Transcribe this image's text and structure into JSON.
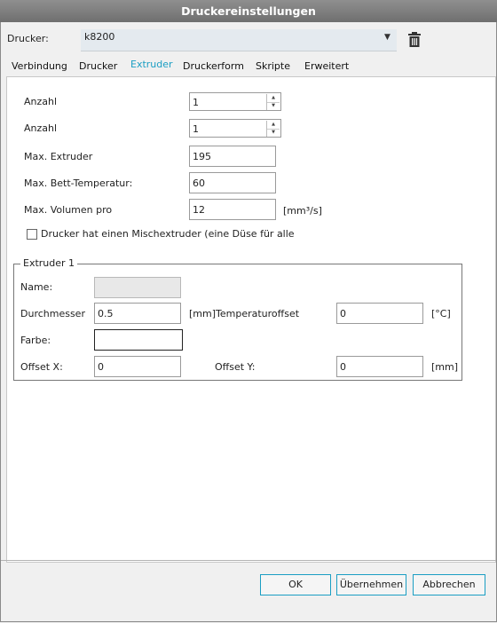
{
  "window": {
    "title": "Druckereinstellungen"
  },
  "printer": {
    "label": "Drucker:",
    "selected": "k8200"
  },
  "icons": {
    "dropdown": "chevron-down-icon",
    "delete": "trash-icon"
  },
  "tabs": [
    {
      "label": "Verbindung"
    },
    {
      "label": "Drucker"
    },
    {
      "label": "Extruder"
    },
    {
      "label": "Druckerform"
    },
    {
      "label": "Skripte"
    },
    {
      "label": "Erweitert"
    }
  ],
  "extruder": {
    "count1_label": "Anzahl",
    "count1_value": "1",
    "count2_label": "Anzahl",
    "count2_value": "1",
    "max_extruder_label": "Max. Extruder",
    "max_extruder_value": "195",
    "max_bed_label": "Max. Bett-Temperatur:",
    "max_bed_value": "60",
    "max_volume_label": "Max. Volumen pro",
    "max_volume_value": "12",
    "max_volume_unit": "[mm³/s]",
    "mixing_label": "Drucker hat einen Mischextruder (eine Düse für alle"
  },
  "extruder1": {
    "title": "Extruder 1",
    "name_label": "Name:",
    "name_value": "",
    "diameter_label": "Durchmesser",
    "diameter_value": "0.5",
    "diameter_unit": "[mm]",
    "temp_offset_label": "Temperaturoffset",
    "temp_offset_value": "0",
    "temp_offset_unit": "[°C]",
    "color_label": "Farbe:",
    "offset_x_label": "Offset X:",
    "offset_x_value": "0",
    "offset_y_label": "Offset Y:",
    "offset_y_value": "0",
    "offset_unit": "[mm]"
  },
  "buttons": {
    "ok": "OK",
    "apply": "Übernehmen",
    "cancel": "Abbrechen"
  },
  "colors": {
    "accent": "#1a9ec3"
  }
}
